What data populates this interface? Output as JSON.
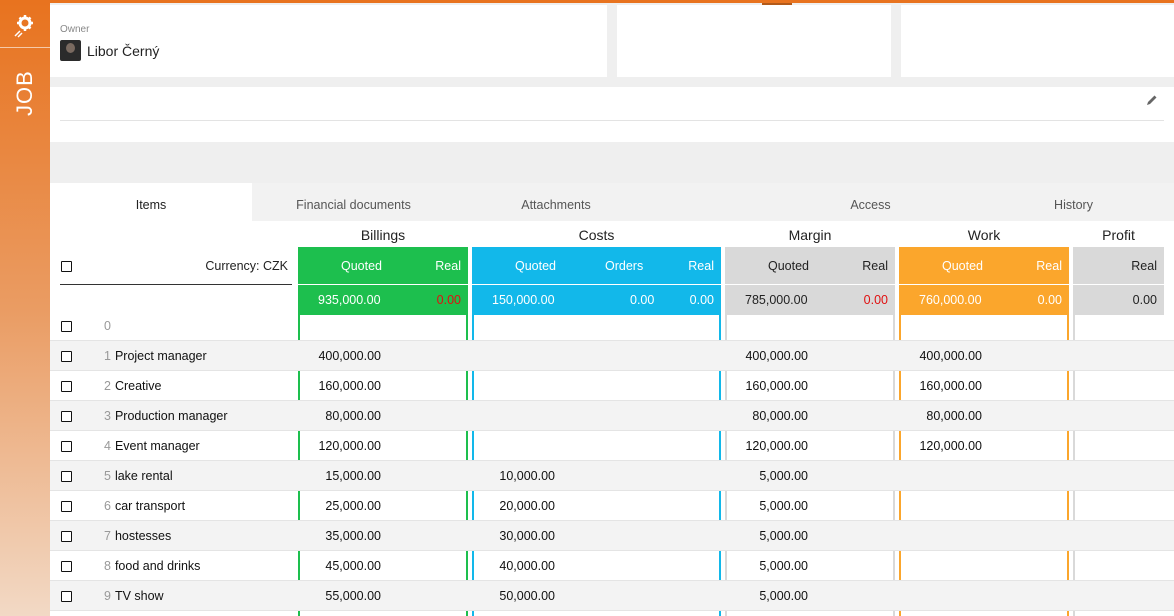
{
  "sidebar": {
    "logo_icon": "rocket-gear-icon",
    "label": "JOB"
  },
  "owner": {
    "label": "Owner",
    "name": "Libor Černý"
  },
  "tabs": [
    "Items",
    "Financial documents",
    "Attachments",
    "Access",
    "History"
  ],
  "table": {
    "currency_label": "Currency: CZK",
    "groups": {
      "billings": "Billings",
      "costs": "Costs",
      "margin": "Margin",
      "work": "Work",
      "profit": "Profit"
    },
    "headers": {
      "billings": {
        "quoted": "Quoted",
        "real": "Real"
      },
      "costs": {
        "quoted": "Quoted",
        "orders": "Orders",
        "real": "Real"
      },
      "margin": {
        "quoted": "Quoted",
        "real": "Real"
      },
      "work": {
        "quoted": "Quoted",
        "real": "Real"
      },
      "profit": {
        "real": "Real"
      }
    },
    "totals": {
      "billings_quoted": "935,000.00",
      "billings_real": "0.00",
      "costs_quoted": "150,000.00",
      "costs_orders": "0.00",
      "costs_real": "0.00",
      "margin_quoted": "785,000.00",
      "margin_real": "0.00",
      "work_quoted": "760,000.00",
      "work_real": "0.00",
      "profit_real": "0.00"
    },
    "rows": [
      {
        "num": "0",
        "name": "",
        "billing": "",
        "cost": "",
        "margin": "",
        "work": ""
      },
      {
        "num": "1",
        "name": "Project manager",
        "billing": "400,000.00",
        "cost": "",
        "margin": "400,000.00",
        "work": "400,000.00"
      },
      {
        "num": "2",
        "name": "Creative",
        "billing": "160,000.00",
        "cost": "",
        "margin": "160,000.00",
        "work": "160,000.00"
      },
      {
        "num": "3",
        "name": "Production manager",
        "billing": "80,000.00",
        "cost": "",
        "margin": "80,000.00",
        "work": "80,000.00"
      },
      {
        "num": "4",
        "name": "Event manager",
        "billing": "120,000.00",
        "cost": "",
        "margin": "120,000.00",
        "work": "120,000.00"
      },
      {
        "num": "5",
        "name": "lake rental",
        "billing": "15,000.00",
        "cost": "10,000.00",
        "margin": "5,000.00",
        "work": ""
      },
      {
        "num": "6",
        "name": "car transport",
        "billing": "25,000.00",
        "cost": "20,000.00",
        "margin": "5,000.00",
        "work": ""
      },
      {
        "num": "7",
        "name": "hostesses",
        "billing": "35,000.00",
        "cost": "30,000.00",
        "margin": "5,000.00",
        "work": ""
      },
      {
        "num": "8",
        "name": "food and drinks",
        "billing": "45,000.00",
        "cost": "40,000.00",
        "margin": "5,000.00",
        "work": ""
      },
      {
        "num": "9",
        "name": "TV show",
        "billing": "55,000.00",
        "cost": "50,000.00",
        "margin": "5,000.00",
        "work": ""
      }
    ]
  },
  "colors": {
    "accent": "#e8731f",
    "billings": "#1dbf4e",
    "costs": "#12b8ea",
    "margin": "#d9d9d9",
    "work": "#fba62c",
    "negative": "#e01010"
  }
}
